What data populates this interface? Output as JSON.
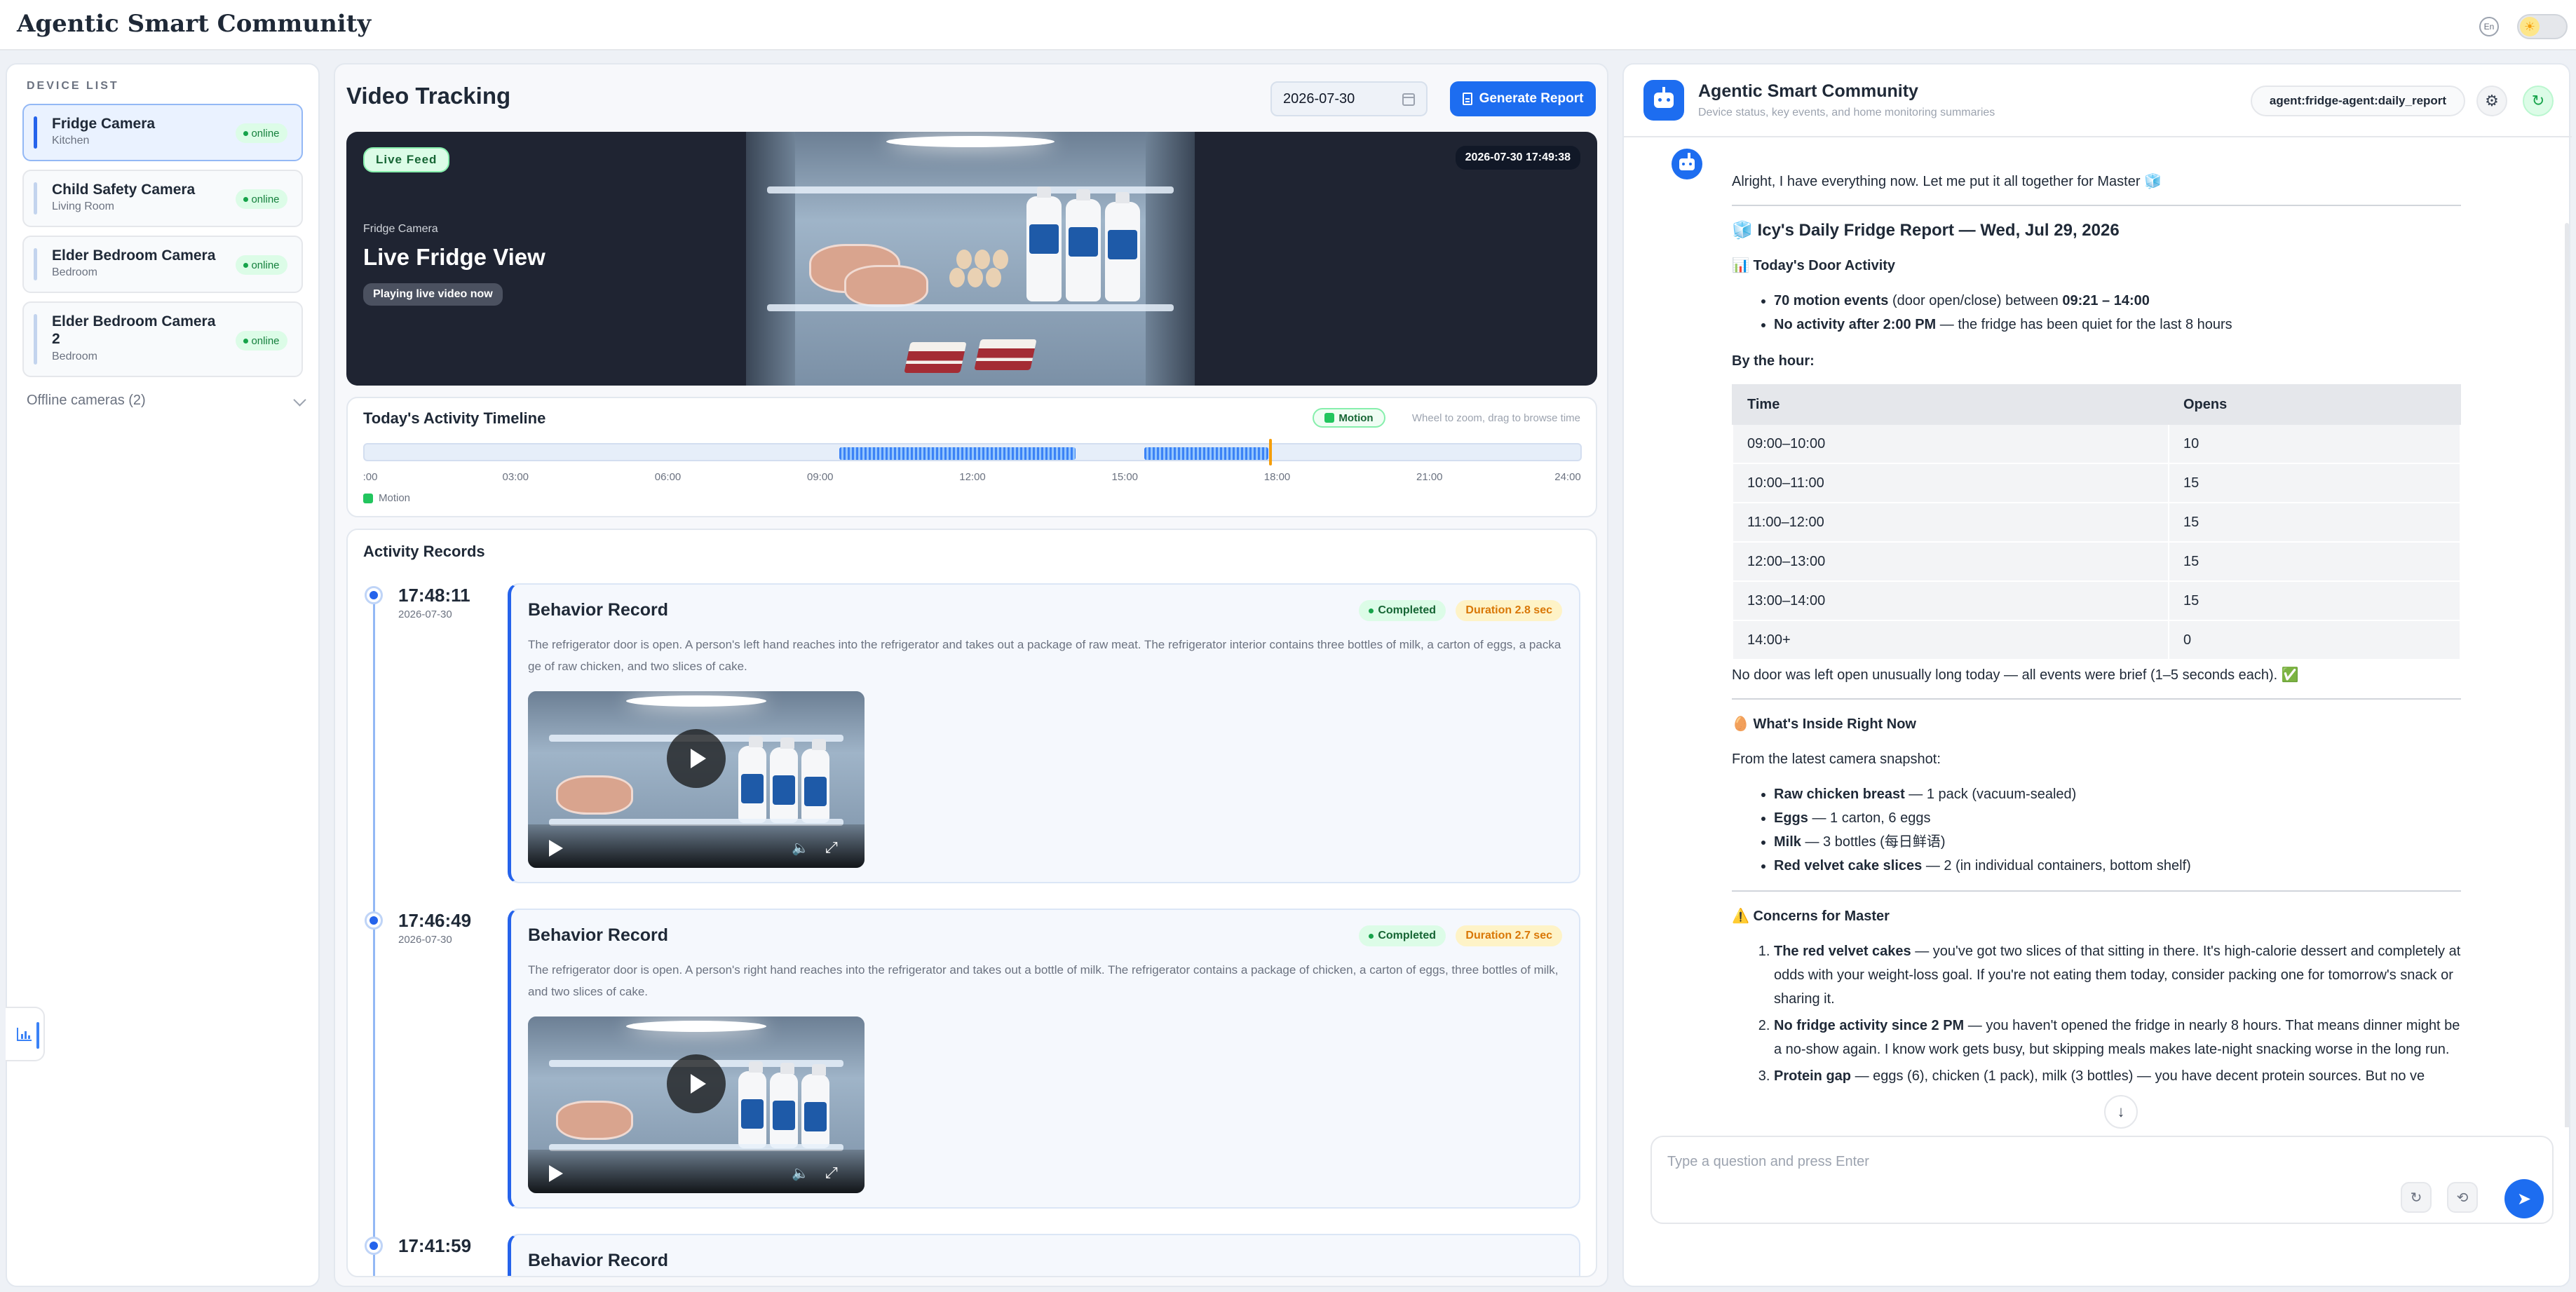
{
  "app": {
    "brand": "Agentic Smart Community",
    "lang": "En",
    "theme_icon": "sun-icon"
  },
  "device_list": {
    "title": "DEVICE LIST",
    "devices": [
      {
        "name": "Fridge Camera",
        "room": "Kitchen",
        "status": "online",
        "active": true
      },
      {
        "name": "Child Safety Camera",
        "room": "Living Room",
        "status": "online"
      },
      {
        "name": "Elder Bedroom Camera",
        "room": "Bedroom",
        "status": "online"
      },
      {
        "name": "Elder Bedroom Camera 2",
        "room": "Bedroom",
        "status": "online"
      }
    ],
    "offline_label": "Offline cameras (2)"
  },
  "video_tracking": {
    "title": "Video Tracking",
    "date": "2026-07-30",
    "generate_label": "Generate Report",
    "live": {
      "badge": "Live Feed",
      "camera": "Fridge Camera",
      "title": "Live Fridge View",
      "status": "Playing live video now",
      "timestamp": "2026-07-30 17:49:38"
    }
  },
  "timeline": {
    "title": "Today's Activity Timeline",
    "badge": "Motion",
    "hint": "Wheel to zoom, drag to browse time",
    "ticks": [
      ":00",
      "03:00",
      "06:00",
      "09:00",
      "12:00",
      "15:00",
      "18:00",
      "21:00",
      "24:00"
    ],
    "legend": "Motion",
    "motion_segments_hours": [
      [
        9.35,
        14.0
      ],
      [
        15.35,
        17.8
      ]
    ],
    "current_hour": 17.82
  },
  "records": {
    "title": "Activity Records",
    "items": [
      {
        "time": "17:48:11",
        "date": "2026-07-30",
        "title": "Behavior Record",
        "status": "Completed",
        "duration": "Duration 2.8 sec",
        "desc": "The refrigerator door is open. A person's left hand reaches into the refrigerator and takes out a package of raw meat. The refrigerator interior contains three bottles of milk, a carton of eggs, a package of raw chicken, and two slices of cake."
      },
      {
        "time": "17:46:49",
        "date": "2026-07-30",
        "title": "Behavior Record",
        "status": "Completed",
        "duration": "Duration 2.7 sec",
        "desc": "The refrigerator door is open. A person's right hand reaches into the refrigerator and takes out a bottle of milk. The refrigerator contains a package of chicken, a carton of eggs, three bottles of milk, and two slices of cake."
      },
      {
        "time": "17:41:59",
        "title": "Behavior Record"
      }
    ]
  },
  "chat": {
    "title": "Agentic Smart Community",
    "subtitle": "Device status, key events, and home monitoring summaries",
    "agent": "agent:fridge-agent:daily_report",
    "intro": "Alright, I have everything now. Let me put it all together for Master 🧊",
    "report_title": "🧊 Icy's Daily Fridge Report — Wed, Jul 29, 2026",
    "door_heading": "📊 Today's Door Activity",
    "door_b1": "70 motion events",
    "door_t1": " (door open/close) between ",
    "door_b2": "09:21 – 14:00",
    "door_b3": "No activity after 2:00 PM",
    "door_t3": " — the fridge has been quiet for the last 8 hours",
    "by_hour": "By the hour:",
    "table_headers": [
      "Time",
      "Opens"
    ],
    "table_rows": [
      [
        "09:00–10:00",
        "10"
      ],
      [
        "10:00–11:00",
        "15"
      ],
      [
        "11:00–12:00",
        "15"
      ],
      [
        "12:00–13:00",
        "15"
      ],
      [
        "13:00–14:00",
        "15"
      ],
      [
        "14:00+",
        "0"
      ]
    ],
    "door_note": "No door was left open unusually long today — all events were brief (1–5 seconds each). ✅",
    "inside_heading": "🥚 What's Inside Right Now",
    "inside_intro": "From the latest camera snapshot:",
    "inside_items": [
      {
        "b": "Raw chicken breast",
        "t": " — 1 pack (vacuum-sealed)"
      },
      {
        "b": "Eggs",
        "t": " — 1 carton, 6 eggs"
      },
      {
        "b": "Milk",
        "t": " — 3 bottles (每日鲜语)"
      },
      {
        "b": "Red velvet cake slices",
        "t": " — 2 (in individual containers, bottom shelf)"
      }
    ],
    "concerns_heading": "⚠️ Concerns for Master",
    "concerns": [
      {
        "b": "The red velvet cakes",
        "t": " — you've got two slices of that sitting in there. It's high-calorie dessert and completely at odds with your weight-loss goal. If you're not eating them today, consider packing one for tomorrow's snack or sharing it."
      },
      {
        "b": "No fridge activity since 2 PM",
        "t": " — you haven't opened the fridge in nearly 8 hours. That means dinner might be a no-show again. I know work gets busy, but skipping meals makes late-night snacking worse in the long run."
      },
      {
        "b": "Protein gap",
        "t": " — eggs (6), chicken (1 pack), milk (3 bottles) — you have decent protein sources. But no ve"
      }
    ],
    "input_placeholder": "Type a question and press Enter"
  }
}
